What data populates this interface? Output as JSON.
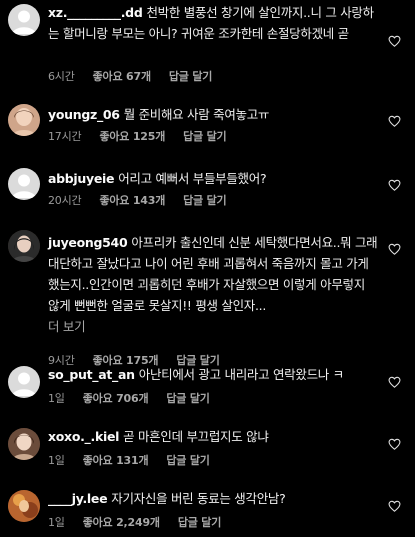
{
  "comments": [
    {
      "username": "xz._________.dd",
      "text": "천박한 별풍선 창기에 살인까지..니 그 사랑하는 할머니랑 부모는 아니? 귀여운 조카한테 손절당하겠네 곧",
      "more": "",
      "time": "6시간",
      "likes": "좋아요 67개",
      "reply": "답글 달기",
      "avatar": "default-avatar-icon"
    },
    {
      "username": "youngz_06",
      "text": "뭘 준비해요 사람 죽여놓고ㅠ",
      "more": "",
      "time": "17시간",
      "likes": "좋아요 125개",
      "reply": "답글 달기",
      "avatar": "profile-photo"
    },
    {
      "username": "abbjuyeie",
      "text": "어리고 예뻐서 부들부들했어?",
      "more": "",
      "time": "20시간",
      "likes": "좋아요 143개",
      "reply": "답글 달기",
      "avatar": "default-avatar-icon"
    },
    {
      "username": "juyeong540",
      "text": "아프리카 출신인데 신분 세탁했다면서요..뭐 그래 대단하고 잘났다고 나이 어린 후배 괴롭혀서 죽음까지 몰고 가게했는지..인간이면 괴롭히던 후배가 자살했으면 이렇게 아무렇지 않게 뻔뻔한 얼굴로 못살지!! 평생 살인자...",
      "more": "더 보기",
      "time": "9시간",
      "likes": "좋아요 175개",
      "reply": "답글 달기",
      "avatar": "profile-photo"
    },
    {
      "username": "so_put_at_an",
      "text": "아난티에서 광고 내리라고 연락왔드나 ㅋ",
      "more": "",
      "time": "1일",
      "likes": "좋아요 706개",
      "reply": "답글 달기",
      "avatar": "default-avatar-icon"
    },
    {
      "username": "xoxo._.kiel",
      "text": "곧 마흔인데 부끄럽지도 않냐",
      "more": "",
      "time": "1일",
      "likes": "좋아요 131개",
      "reply": "답글 달기",
      "avatar": "profile-photo"
    },
    {
      "username": "____jy.lee",
      "text": "자기자신을 버린 동료는 생각안남?",
      "more": "",
      "time": "1일",
      "likes": "좋아요 2,249개",
      "reply": "답글 달기",
      "avatar": "profile-photo"
    }
  ],
  "icons": {
    "like": "heart-outline-icon"
  },
  "colors": {
    "background": "#000000",
    "text": "#f5f5f5",
    "meta": "#a8a8a8",
    "default_avatar": "#dbdbdb"
  }
}
